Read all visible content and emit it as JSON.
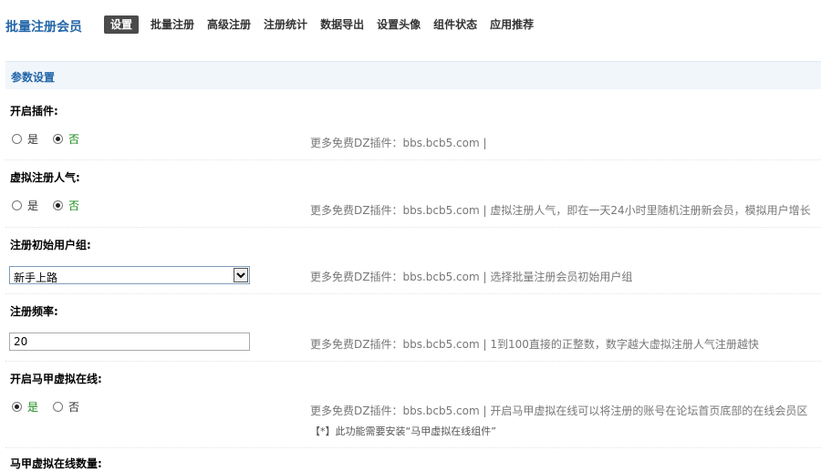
{
  "header": {
    "title": "批量注册会员",
    "tabs": [
      {
        "label": "设置",
        "active": true
      },
      {
        "label": "批量注册"
      },
      {
        "label": "高级注册"
      },
      {
        "label": "注册统计"
      },
      {
        "label": "数据导出"
      },
      {
        "label": "设置头像"
      },
      {
        "label": "组件状态"
      },
      {
        "label": "应用推荐"
      }
    ]
  },
  "section": {
    "title": "参数设置"
  },
  "settings": {
    "enable_plugin": {
      "label": "开启插件:",
      "yes": "是",
      "no": "否",
      "selected": "no",
      "hint": "更多免费DZ插件：bbs.bcb5.com |"
    },
    "virtual_popularity": {
      "label": "虚拟注册人气:",
      "yes": "是",
      "no": "否",
      "selected": "no",
      "hint": "更多免费DZ插件：bbs.bcb5.com | 虚拟注册人气，即在一天24小时里随机注册新会员，模拟用户增长"
    },
    "initial_group": {
      "label": "注册初始用户组:",
      "value": "新手上路",
      "hint": "更多免费DZ插件：bbs.bcb5.com | 选择批量注册会员初始用户组"
    },
    "frequency": {
      "label": "注册频率:",
      "value": "20",
      "hint": "更多免费DZ插件：bbs.bcb5.com | 1到100直接的正整数，数字越大虚拟注册人气注册越快"
    },
    "vest_online": {
      "label": "开启马甲虚拟在线:",
      "yes": "是",
      "no": "否",
      "selected": "yes",
      "hint": "更多免费DZ插件：bbs.bcb5.com | 开启马甲虚拟在线可以将注册的账号在论坛首页底部的在线会员区",
      "note": "【*】此功能需要安装“马甲虚拟在线组件”"
    },
    "vest_online_count": {
      "label": "马甲虚拟在线数量:"
    }
  },
  "colors": {
    "accent": "#2366a8",
    "selected_radio_text": "#1a8a1a",
    "header_bg": "#f1f6fb"
  }
}
